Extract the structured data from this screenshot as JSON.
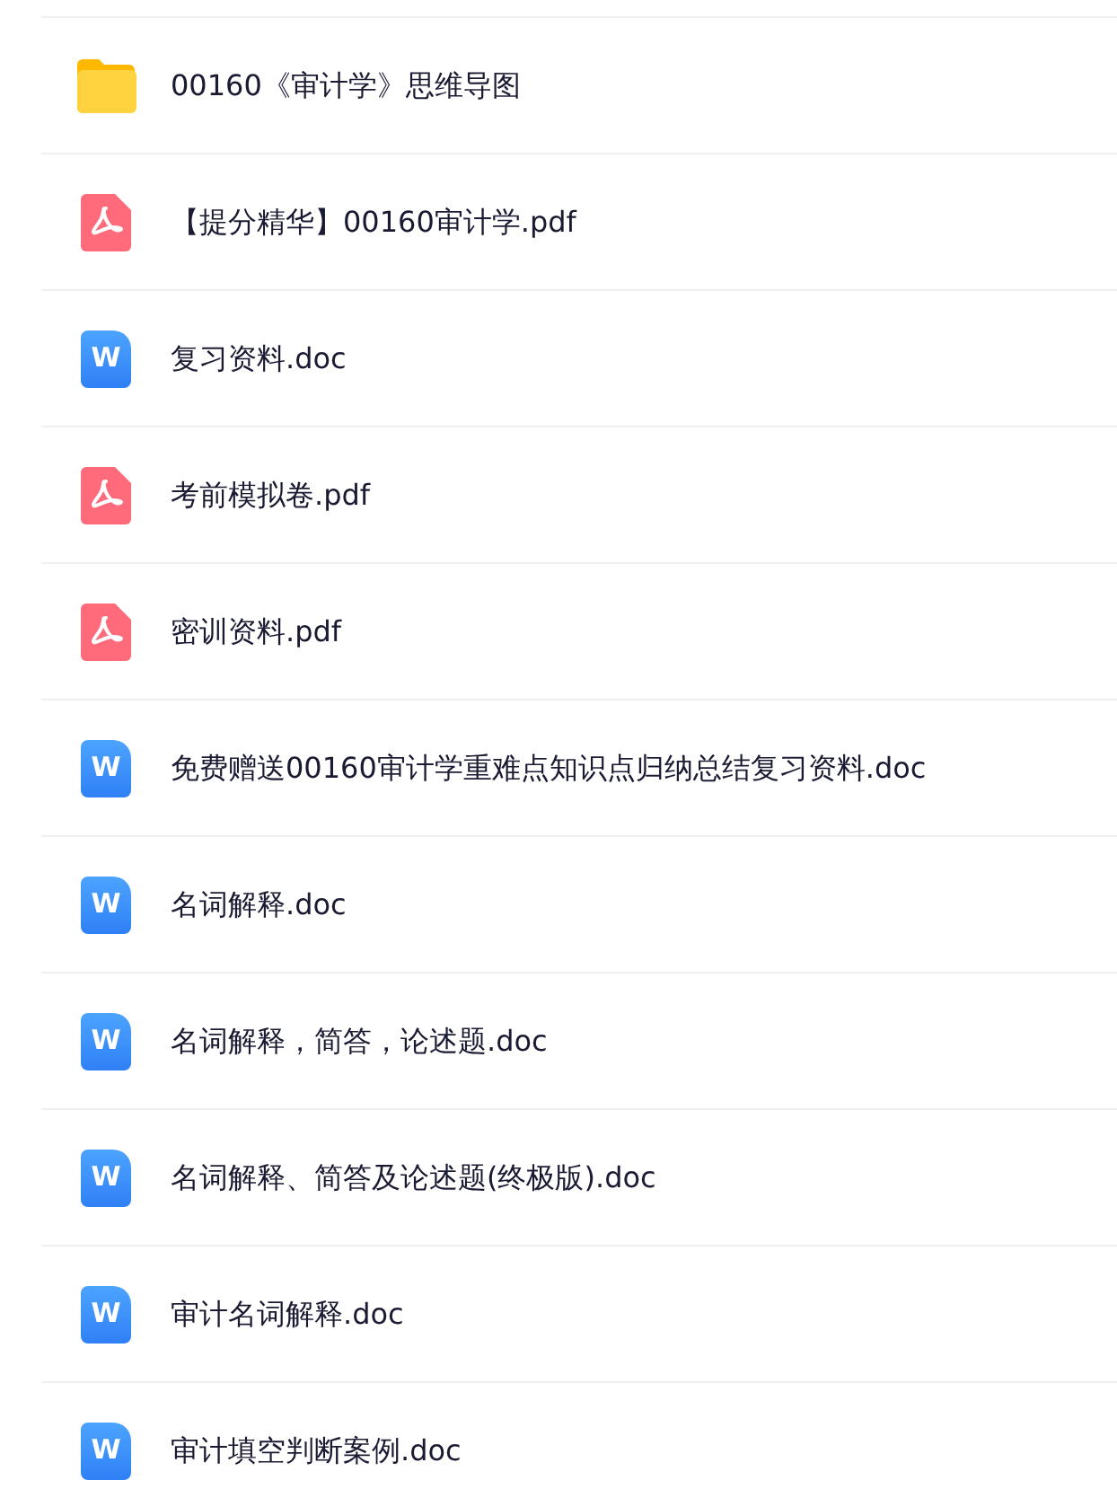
{
  "files": [
    {
      "kind": "folder",
      "name": "00160《审计学》思维导图"
    },
    {
      "kind": "pdf",
      "name": "【提分精华】00160审计学.pdf"
    },
    {
      "kind": "doc",
      "badge": "W",
      "name": "复习资料.doc"
    },
    {
      "kind": "pdf",
      "name": "考前模拟卷.pdf"
    },
    {
      "kind": "pdf",
      "name": "密训资料.pdf"
    },
    {
      "kind": "doc",
      "badge": "W",
      "name": "免费赠送00160审计学重难点知识点归纳总结复习资料.doc"
    },
    {
      "kind": "doc",
      "badge": "W",
      "name": "名词解释.doc"
    },
    {
      "kind": "doc",
      "badge": "W",
      "name": "名词解释，简答，论述题.doc"
    },
    {
      "kind": "doc",
      "badge": "W",
      "name": "名词解释、简答及论述题(终极版).doc"
    },
    {
      "kind": "doc",
      "badge": "W",
      "name": "审计名词解释.doc"
    },
    {
      "kind": "doc",
      "badge": "W",
      "name": "审计填空判断案例.doc"
    }
  ]
}
